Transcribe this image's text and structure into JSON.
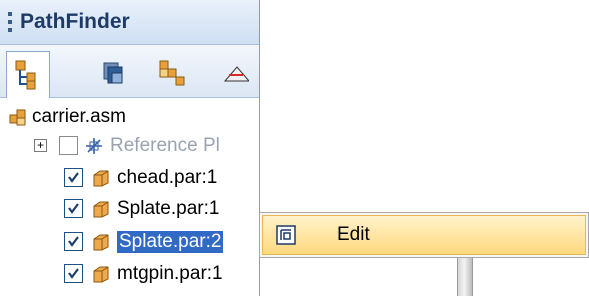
{
  "pathfinder": {
    "title": "PathFinder",
    "tabs": [
      {
        "icon": "assembly-tree-icon",
        "active": true
      },
      {
        "icon": "layers-icon",
        "active": false
      },
      {
        "icon": "parts-library-icon",
        "active": false
      },
      {
        "icon": "sketch-icon",
        "active": false
      }
    ],
    "tree": {
      "root": {
        "label": "carrier.asm",
        "icon": "assembly-icon"
      },
      "items": [
        {
          "label": "Reference Pl",
          "icon": "reference-planes-icon",
          "checked": false,
          "disabled": true,
          "expander": "+"
        },
        {
          "label": "chead.par:1",
          "icon": "part-icon",
          "checked": true
        },
        {
          "label": "Splate.par:1",
          "icon": "part-icon",
          "checked": true
        },
        {
          "label": "Splate.par:2",
          "icon": "part-icon",
          "checked": true,
          "selected": true
        },
        {
          "label": "mtgpin.par:1",
          "icon": "part-icon",
          "checked": true
        }
      ]
    }
  },
  "context_menu": {
    "items": [
      {
        "label": "Edit",
        "icon": "edit-icon",
        "highlighted": true
      }
    ]
  },
  "colors": {
    "header_text": "#1d3b66",
    "selection": "#316ac5",
    "menu_highlight": "#ffd87e"
  }
}
